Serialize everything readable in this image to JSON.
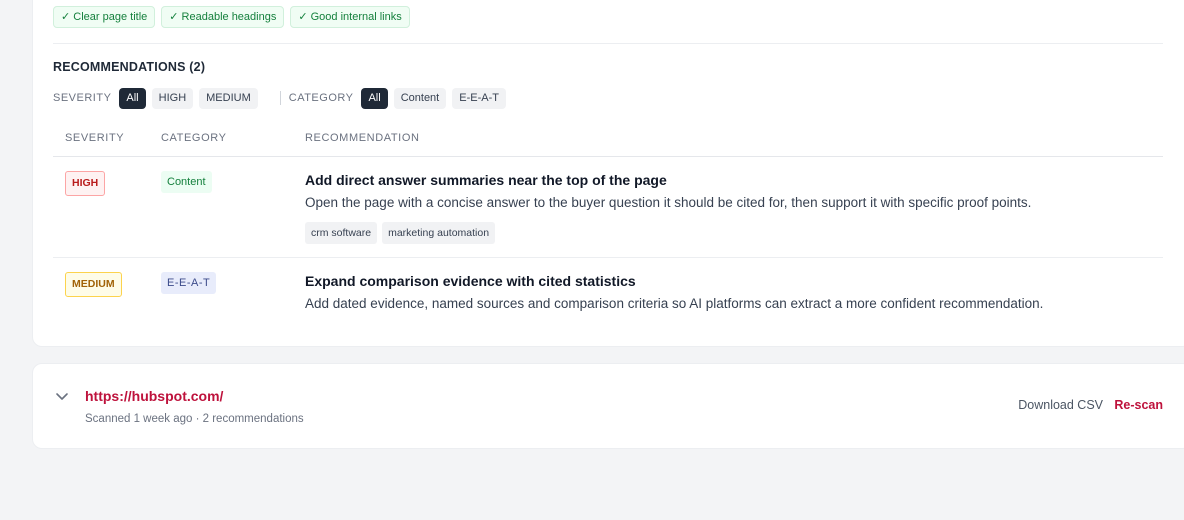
{
  "strengths": [
    "✓ Clear page title",
    "✓ Readable headings",
    "✓ Good internal links"
  ],
  "recommendations": {
    "title": "RECOMMENDATIONS (2)",
    "severity_label": "SEVERITY",
    "severity_options": [
      "All",
      "HIGH",
      "MEDIUM"
    ],
    "category_label": "CATEGORY",
    "category_options": [
      "All",
      "Content",
      "E-E-A-T"
    ],
    "columns": [
      "SEVERITY",
      "CATEGORY",
      "RECOMMENDATION"
    ],
    "rows": [
      {
        "severity": "HIGH",
        "category": "Content",
        "title": "Add direct answer summaries near the top of the page",
        "description": "Open the page with a concise answer to the buyer question it should be cited for, then support it with specific proof points.",
        "tags": [
          "crm software",
          "marketing automation"
        ]
      },
      {
        "severity": "MEDIUM",
        "category": "E-E-A-T",
        "title": "Expand comparison evidence with cited statistics",
        "description": "Add dated evidence, named sources and comparison criteria so AI platforms can extract a more confident recommendation."
      }
    ]
  },
  "site": {
    "url": "https://hubspot.com/",
    "meta": "Scanned 1 week ago · 2 recommendations",
    "download_label": "Download CSV",
    "rescan_label": "Re-scan"
  },
  "colors": {
    "accent": "#be123c",
    "high": "#b91c1c",
    "medium": "#a16207",
    "good": "#15803d"
  },
  "icons": {
    "expand": "chevron-down-icon"
  }
}
